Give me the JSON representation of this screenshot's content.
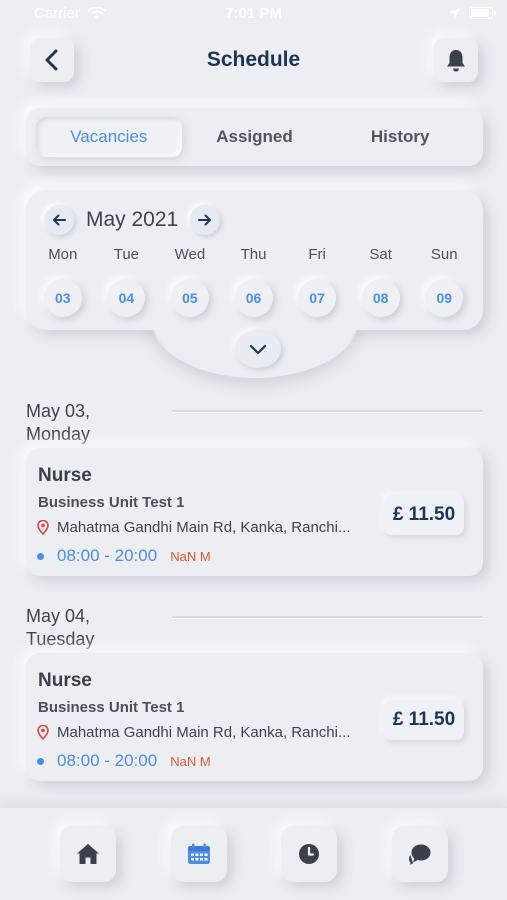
{
  "status_bar": {
    "carrier": "Carrier",
    "time": "7:01 PM"
  },
  "header": {
    "title": "Schedule",
    "back_icon": "chevron-left-icon",
    "bell_icon": "bell-icon"
  },
  "tabs": [
    {
      "label": "Vacancies",
      "active": true
    },
    {
      "label": "Assigned",
      "active": false
    },
    {
      "label": "History",
      "active": false
    }
  ],
  "calendar": {
    "month": "May 2021",
    "weekdays": [
      "Mon",
      "Tue",
      "Wed",
      "Thu",
      "Fri",
      "Sat",
      "Sun"
    ],
    "dates": [
      "03",
      "04",
      "05",
      "06",
      "07",
      "08",
      "09"
    ]
  },
  "days": [
    {
      "date_line1": "May 03,",
      "date_line2": "Monday",
      "shift": {
        "role": "Nurse",
        "unit": "Business Unit Test 1",
        "address": "Mahatma Gandhi Main Rd, Kanka, Ranchi...",
        "time": "08:00 - 20:00",
        "distance": "NaN M",
        "price": "£ 11.50"
      }
    },
    {
      "date_line1": "May 04,",
      "date_line2": "Tuesday",
      "shift": {
        "role": "Nurse",
        "unit": "Business Unit Test 1",
        "address": "Mahatma Gandhi Main Rd, Kanka, Ranchi...",
        "time": "08:00 - 20:00",
        "distance": "NaN M",
        "price": "£ 11.50"
      }
    }
  ],
  "colors": {
    "accent": "#4a8fe7",
    "title": "#1d3557",
    "distance": "#e4582f",
    "background": "#eceef2"
  },
  "bottom_nav": [
    {
      "icon": "home-icon",
      "active": false
    },
    {
      "icon": "calendar-icon",
      "active": true
    },
    {
      "icon": "clock-icon",
      "active": false
    },
    {
      "icon": "chat-icon",
      "active": false
    }
  ]
}
